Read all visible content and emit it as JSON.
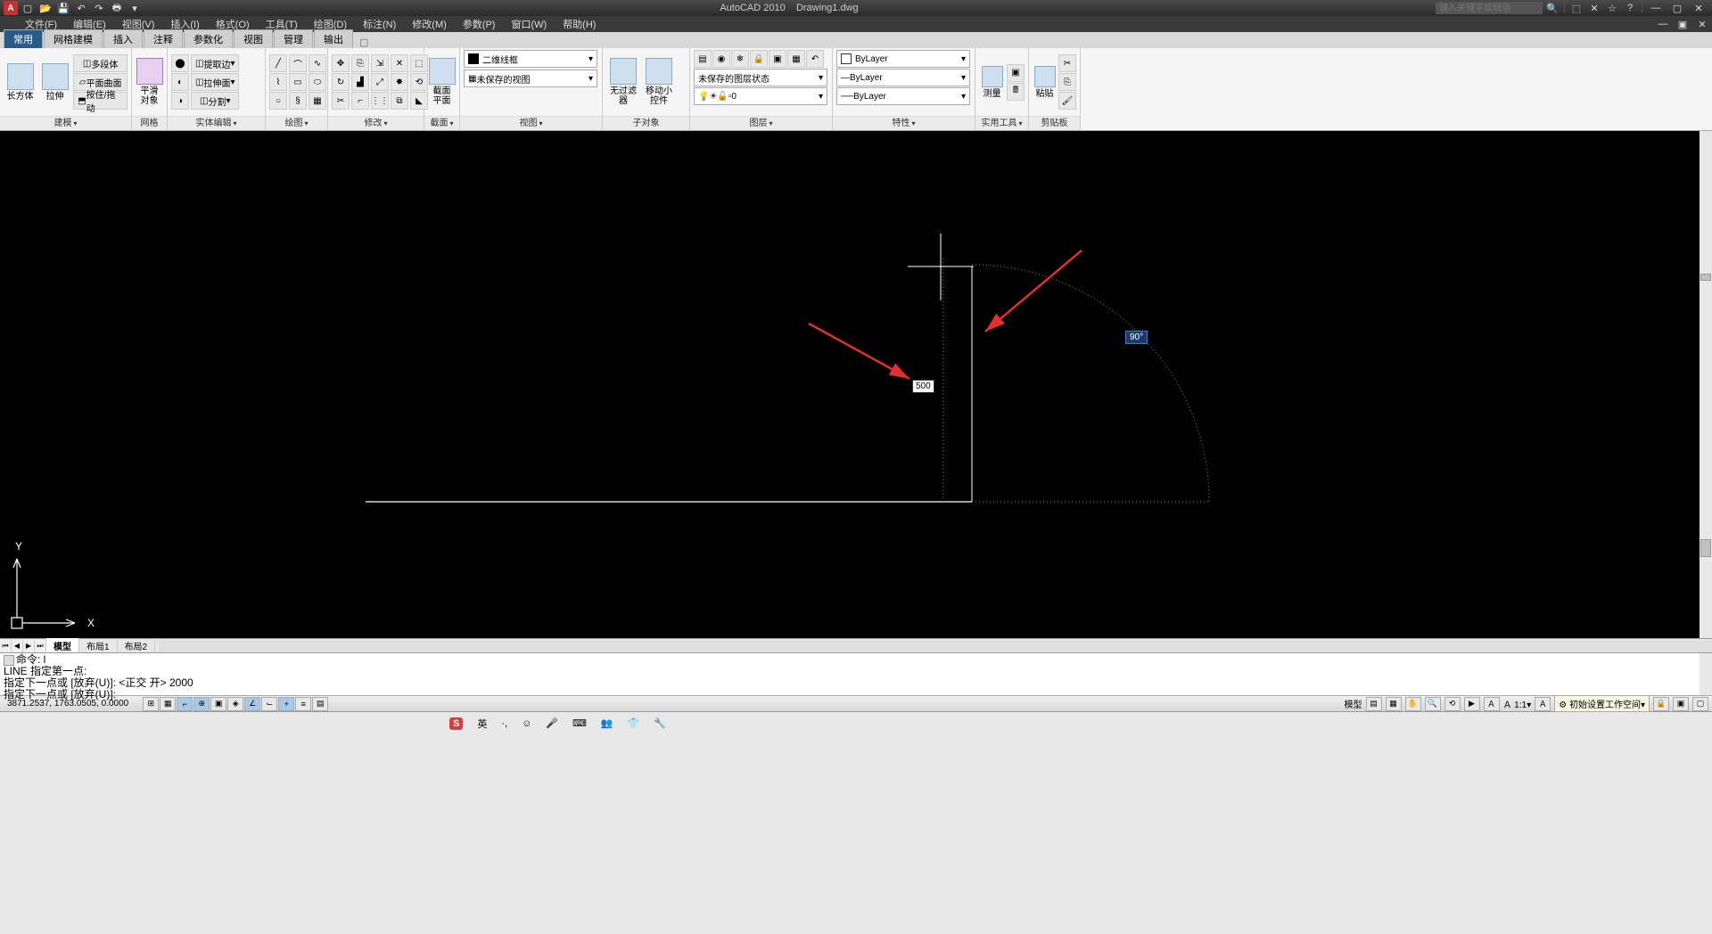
{
  "titlebar": {
    "app_name": "AutoCAD 2010",
    "doc_name": "Drawing1.dwg",
    "search_placeholder": "键入关键字或短语"
  },
  "menubar": {
    "items": [
      "文件(F)",
      "编辑(E)",
      "视图(V)",
      "插入(I)",
      "格式(O)",
      "工具(T)",
      "绘图(D)",
      "标注(N)",
      "修改(M)",
      "参数(P)",
      "窗口(W)",
      "帮助(H)"
    ]
  },
  "tabs": {
    "items": [
      "常用",
      "网格建模",
      "插入",
      "注释",
      "参数化",
      "视图",
      "管理",
      "输出"
    ],
    "active": 0
  },
  "ribbon": {
    "panels": [
      {
        "label": "建模",
        "has_dd": true
      },
      {
        "label": "网格",
        "has_dd": false
      },
      {
        "label": "实体编辑",
        "has_dd": true
      },
      {
        "label": "绘图",
        "has_dd": true
      },
      {
        "label": "修改",
        "has_dd": true
      },
      {
        "label": "截面",
        "has_dd": true
      },
      {
        "label": "视图",
        "has_dd": true
      },
      {
        "label": "子对象",
        "has_dd": false
      },
      {
        "label": "图层",
        "has_dd": true
      },
      {
        "label": "特性",
        "has_dd": true
      },
      {
        "label": "实用工具",
        "has_dd": true
      },
      {
        "label": "剪贴板",
        "has_dd": false
      }
    ],
    "btn_box": "长方体",
    "btn_extrude": "拉伸",
    "btn_polysolid": "多段体",
    "btn_planesurf": "平面曲面",
    "btn_presspull": "按住/拖动",
    "btn_smooth": "平滑\n对象",
    "btn_extract": "提取边",
    "btn_extrudeface": "拉伸面",
    "btn_separate": "分割",
    "btn_section": "截面\n平面",
    "btn_nofilter": "无过滤器",
    "btn_gizmo": "移动小控件",
    "btn_measure": "测量",
    "btn_paste": "粘贴",
    "combo_2dwire": "二维线框",
    "combo_view": "未保存的视图",
    "combo_layerstate": "未保存的图层状态",
    "combo_layer0": "0",
    "combo_bylayer": "ByLayer"
  },
  "drawing": {
    "dim_value": "500",
    "angle_value": "90°",
    "axis_y": "Y",
    "axis_x": "X"
  },
  "layout_tabs": {
    "items": [
      "模型",
      "布局1",
      "布局2"
    ],
    "active": 0
  },
  "cmdline": {
    "line1": "命令: l",
    "line2": "LINE 指定第一点:",
    "line3": "指定下一点或 [放弃(U)]:  <正交 开> 2000",
    "line4": "指定下一点或 [放弃(U)]:"
  },
  "statusbar": {
    "coords": "3871.2537, 1763.0505, 0.0000",
    "model": "模型",
    "workspace": "初始设置工作空间",
    "scale": "1:1"
  },
  "taskbar": {
    "ime_s": "S",
    "ime_lang": "英",
    "dot": "·,"
  }
}
